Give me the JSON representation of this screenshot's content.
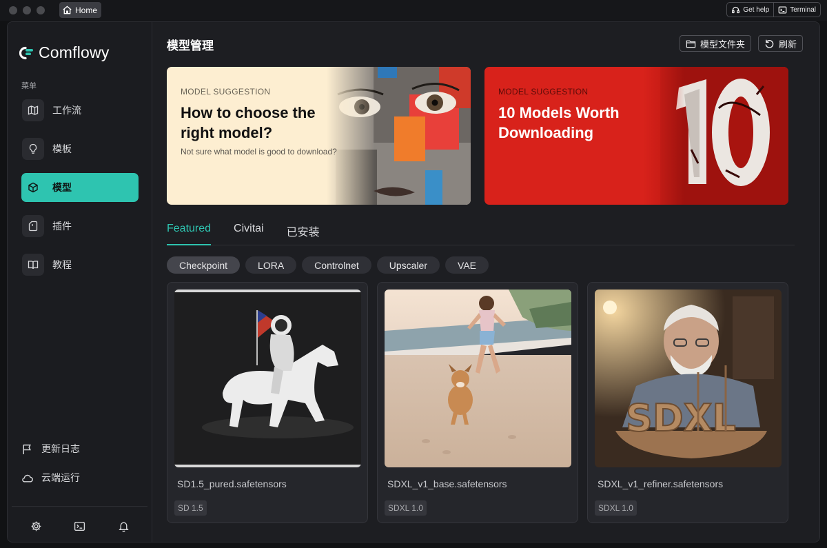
{
  "titlebar": {
    "home_tab": "Home",
    "get_help": "Get help",
    "terminal": "Terminal"
  },
  "sidebar": {
    "logo_text": "Comflowy",
    "menu_caption": "菜单",
    "items": [
      {
        "label": "工作流",
        "icon": "map-icon"
      },
      {
        "label": "模板",
        "icon": "lightbulb-icon"
      },
      {
        "label": "模型",
        "icon": "cube-icon",
        "active": true
      },
      {
        "label": "插件",
        "icon": "plugin-icon"
      },
      {
        "label": "教程",
        "icon": "book-icon"
      }
    ],
    "bottom_links": [
      {
        "label": "更新日志",
        "icon": "flag-icon"
      },
      {
        "label": "云端运行",
        "icon": "cloud-icon"
      }
    ],
    "tools": [
      "settings-icon",
      "terminal-icon",
      "bell-icon"
    ]
  },
  "main": {
    "title": "模型管理",
    "folder_button": "模型文件夹",
    "refresh_button": "刷新",
    "banners": [
      {
        "eyebrow": "MODEL SUGGESTION",
        "title": "How to choose the right model?",
        "subtitle": "Not sure what model is good to download?"
      },
      {
        "eyebrow": "MODEL SUGGESTION",
        "title": "10 Models Worth Downloading"
      }
    ],
    "tabs": [
      "Featured",
      "Civitai",
      "已安装"
    ],
    "active_tab": "Featured",
    "filters": [
      "Checkpoint",
      "LORA",
      "Controlnet",
      "Upscaler",
      "VAE"
    ],
    "active_filter": "Checkpoint",
    "models": [
      {
        "name": "SD1.5_pured.safetensors",
        "tag": "SD 1.5"
      },
      {
        "name": "SDXL_v1_base.safetensors",
        "tag": "SDXL 1.0"
      },
      {
        "name": "SDXL_v1_refiner.safetensors",
        "tag": "SDXL 1.0"
      }
    ]
  },
  "colors": {
    "accent": "#2ec4b0",
    "banner_red": "#d8221b",
    "banner_cream": "#fdeed1"
  }
}
